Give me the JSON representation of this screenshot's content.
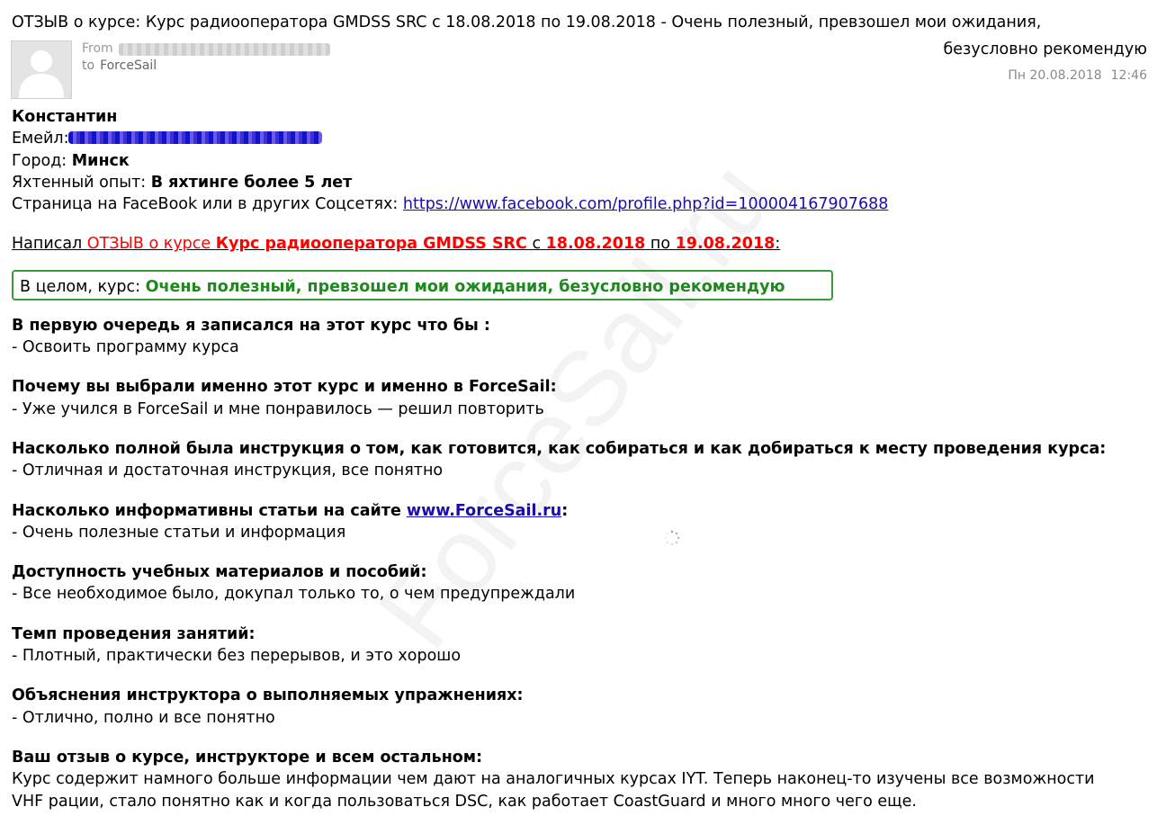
{
  "email": {
    "subject_line1": "ОТЗЫВ о курсе: Курс радиооператора GMDSS SRC с 18.08.2018 по 19.08.2018 - Очень полезный, превзошел мои ожидания,",
    "subject_line2": "безусловно рекомендую",
    "from_label": "From",
    "to_label": "to",
    "to_name": "ForceSail",
    "date": "Пн 20.08.2018",
    "time": "12:46",
    "avatar_icon": "default-user-avatar-icon"
  },
  "profile": {
    "name": "Константин",
    "email_label": "Емейл:",
    "city_label": "Город: ",
    "city": "Минск",
    "experience_label": "Яхтенный опыт: ",
    "experience": "В яхтинге более 5 лет",
    "social_label": "Страница на FaceBook или в других Соцсетях: ",
    "social_link": "https://www.facebook.com/profile.php?id=100004167907688"
  },
  "wrote": {
    "prefix": "Написал ",
    "review_word": "ОТЗЫВ о курсе ",
    "course": "Курс радиооператора GMDSS SRC",
    "from_word": " с ",
    "date_from": "18.08.2018",
    "to_word": " по ",
    "date_to": "19.08.2018",
    "colon": ":"
  },
  "overall": {
    "label": "В целом, курс: ",
    "value": "Очень полезный, превзошел мои ожидания, безусловно рекомендую"
  },
  "qa": [
    {
      "q": "В первую очередь я записался на этот курс что бы :",
      "a": "- Освоить программу курса"
    },
    {
      "q": "Почему вы выбрали именно этот курс и именно в ForceSail:",
      "a": "- Уже учился в ForceSail и мне понравилось — решил повторить"
    },
    {
      "q": "Насколько полной была инструкция о том, как готовится, как собираться и как добираться к месту проведения курса:",
      "a": "- Отличная и достаточная инструкция, все понятно"
    },
    {
      "q_prefix": "Насколько информативны статьи на сайте ",
      "q_link": "www.ForceSail.ru",
      "q_suffix": ":",
      "a": "- Очень полезные статьи и информация"
    },
    {
      "q": "Доступность учебных материалов и пособий:",
      "a": "- Все необходимое было, докупал только то, о чем предупреждали"
    },
    {
      "q": "Темп проведения занятий:",
      "a": "- Плотный, практически без перерывов, и это хорошо"
    },
    {
      "q": "Объяснения инструктора о выполняемых упражнениях:",
      "a": "- Отлично, полно и все понятно"
    },
    {
      "q": "Ваш отзыв о курсе, инструкторе и всем остальном:",
      "a": "Курс содержит намного больше информации чем дают на аналогичных курсах IYT. Теперь наконец-то изучены все возможности VHF рации, стало понятно как и  когда пользоваться DSC, как работает CoastGuard и много много чего еще."
    }
  ],
  "watermark": "ForceSail.ru"
}
